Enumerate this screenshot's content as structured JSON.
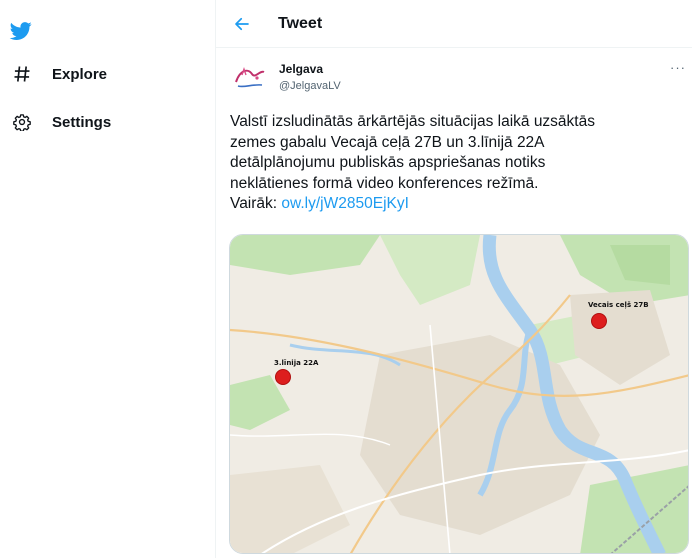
{
  "sidebar": {
    "items": [
      {
        "label": "Explore",
        "icon": "hashtag-icon"
      },
      {
        "label": "Settings",
        "icon": "gear-icon"
      }
    ]
  },
  "header": {
    "title": "Tweet"
  },
  "tweet": {
    "author_name": "Jelgava",
    "author_handle": "@JelgavaLV",
    "more": "···",
    "text_lines": [
      "Valstī izsludinātās ārkārtējās situācijas laikā uzsāktās",
      "zemes gabalu Vecajā ceļā 27B un 3.līnijā 22A",
      "detālplānojumu publiskās apspriešanas notiks",
      "neklātienes formā video konferences režīmā."
    ],
    "link_prefix": "Vairāk: ",
    "link_text": "ow.ly/jW2850EjKyI",
    "map": {
      "labels": [
        {
          "text": "3.līnija 22A"
        },
        {
          "text": "Vecais ceļš 27B"
        }
      ]
    }
  },
  "colors": {
    "accent": "#1d9bf0",
    "marker": "#dd1e1e",
    "river": "#a9cfee",
    "park": "#c3e3b2"
  }
}
